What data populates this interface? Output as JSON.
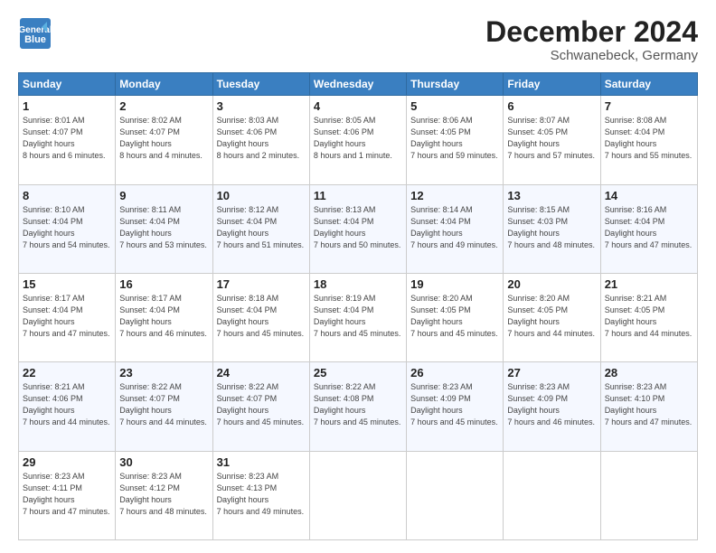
{
  "header": {
    "logo_line1": "General",
    "logo_line2": "Blue",
    "title": "December 2024",
    "subtitle": "Schwanebeck, Germany"
  },
  "columns": [
    "Sunday",
    "Monday",
    "Tuesday",
    "Wednesday",
    "Thursday",
    "Friday",
    "Saturday"
  ],
  "weeks": [
    [
      {
        "day": "1",
        "rise": "8:01 AM",
        "set": "4:07 PM",
        "daylight": "8 hours and 6 minutes."
      },
      {
        "day": "2",
        "rise": "8:02 AM",
        "set": "4:07 PM",
        "daylight": "8 hours and 4 minutes."
      },
      {
        "day": "3",
        "rise": "8:03 AM",
        "set": "4:06 PM",
        "daylight": "8 hours and 2 minutes."
      },
      {
        "day": "4",
        "rise": "8:05 AM",
        "set": "4:06 PM",
        "daylight": "8 hours and 1 minute."
      },
      {
        "day": "5",
        "rise": "8:06 AM",
        "set": "4:05 PM",
        "daylight": "7 hours and 59 minutes."
      },
      {
        "day": "6",
        "rise": "8:07 AM",
        "set": "4:05 PM",
        "daylight": "7 hours and 57 minutes."
      },
      {
        "day": "7",
        "rise": "8:08 AM",
        "set": "4:04 PM",
        "daylight": "7 hours and 55 minutes."
      }
    ],
    [
      {
        "day": "8",
        "rise": "8:10 AM",
        "set": "4:04 PM",
        "daylight": "7 hours and 54 minutes."
      },
      {
        "day": "9",
        "rise": "8:11 AM",
        "set": "4:04 PM",
        "daylight": "7 hours and 53 minutes."
      },
      {
        "day": "10",
        "rise": "8:12 AM",
        "set": "4:04 PM",
        "daylight": "7 hours and 51 minutes."
      },
      {
        "day": "11",
        "rise": "8:13 AM",
        "set": "4:04 PM",
        "daylight": "7 hours and 50 minutes."
      },
      {
        "day": "12",
        "rise": "8:14 AM",
        "set": "4:04 PM",
        "daylight": "7 hours and 49 minutes."
      },
      {
        "day": "13",
        "rise": "8:15 AM",
        "set": "4:03 PM",
        "daylight": "7 hours and 48 minutes."
      },
      {
        "day": "14",
        "rise": "8:16 AM",
        "set": "4:04 PM",
        "daylight": "7 hours and 47 minutes."
      }
    ],
    [
      {
        "day": "15",
        "rise": "8:17 AM",
        "set": "4:04 PM",
        "daylight": "7 hours and 47 minutes."
      },
      {
        "day": "16",
        "rise": "8:17 AM",
        "set": "4:04 PM",
        "daylight": "7 hours and 46 minutes."
      },
      {
        "day": "17",
        "rise": "8:18 AM",
        "set": "4:04 PM",
        "daylight": "7 hours and 45 minutes."
      },
      {
        "day": "18",
        "rise": "8:19 AM",
        "set": "4:04 PM",
        "daylight": "7 hours and 45 minutes."
      },
      {
        "day": "19",
        "rise": "8:20 AM",
        "set": "4:05 PM",
        "daylight": "7 hours and 45 minutes."
      },
      {
        "day": "20",
        "rise": "8:20 AM",
        "set": "4:05 PM",
        "daylight": "7 hours and 44 minutes."
      },
      {
        "day": "21",
        "rise": "8:21 AM",
        "set": "4:05 PM",
        "daylight": "7 hours and 44 minutes."
      }
    ],
    [
      {
        "day": "22",
        "rise": "8:21 AM",
        "set": "4:06 PM",
        "daylight": "7 hours and 44 minutes."
      },
      {
        "day": "23",
        "rise": "8:22 AM",
        "set": "4:07 PM",
        "daylight": "7 hours and 44 minutes."
      },
      {
        "day": "24",
        "rise": "8:22 AM",
        "set": "4:07 PM",
        "daylight": "7 hours and 45 minutes."
      },
      {
        "day": "25",
        "rise": "8:22 AM",
        "set": "4:08 PM",
        "daylight": "7 hours and 45 minutes."
      },
      {
        "day": "26",
        "rise": "8:23 AM",
        "set": "4:09 PM",
        "daylight": "7 hours and 45 minutes."
      },
      {
        "day": "27",
        "rise": "8:23 AM",
        "set": "4:09 PM",
        "daylight": "7 hours and 46 minutes."
      },
      {
        "day": "28",
        "rise": "8:23 AM",
        "set": "4:10 PM",
        "daylight": "7 hours and 47 minutes."
      }
    ],
    [
      {
        "day": "29",
        "rise": "8:23 AM",
        "set": "4:11 PM",
        "daylight": "7 hours and 47 minutes."
      },
      {
        "day": "30",
        "rise": "8:23 AM",
        "set": "4:12 PM",
        "daylight": "7 hours and 48 minutes."
      },
      {
        "day": "31",
        "rise": "8:23 AM",
        "set": "4:13 PM",
        "daylight": "7 hours and 49 minutes."
      },
      null,
      null,
      null,
      null
    ]
  ]
}
